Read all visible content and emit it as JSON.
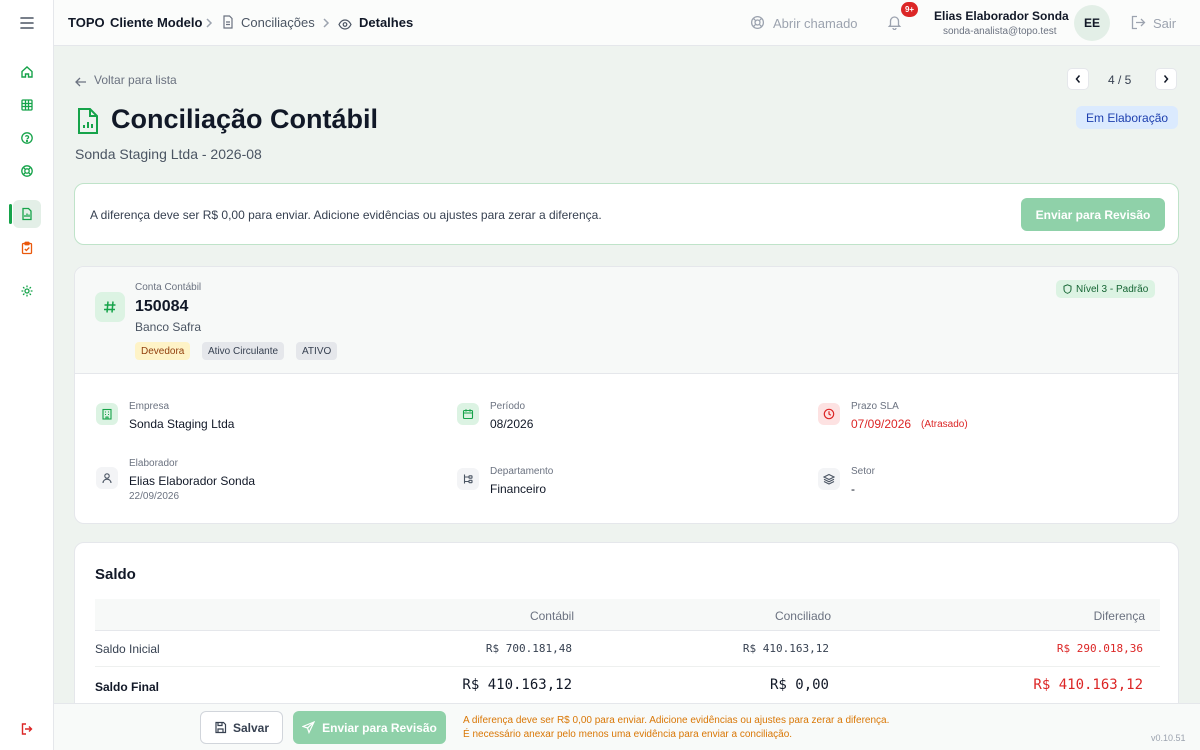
{
  "header": {
    "brand": "TOPO",
    "breadcrumb": {
      "client": "Cliente Modelo",
      "section": "Conciliações",
      "current": "Detalhes"
    },
    "ticket_label": "Abrir chamado",
    "notifications_badge": "9+",
    "user_name": "Elias Elaborador Sonda",
    "user_email": "sonda-analista@topo.test",
    "avatar_initials": "EE",
    "logout_label": "Sair"
  },
  "nav": {
    "back_label": "Voltar para lista",
    "pager": "4 / 5"
  },
  "page": {
    "title": "Conciliação Contábil",
    "subtitle": "Sonda Staging Ltda - 2026-08",
    "status": "Em Elaboração"
  },
  "alert": {
    "message": "A diferença deve ser R$ 0,00 para enviar. Adicione evidências ou ajustes para zerar a diferença.",
    "button": "Enviar para Revisão"
  },
  "account": {
    "label": "Conta Contábil",
    "number": "150084",
    "bank": "Banco Safra",
    "chips": [
      "Devedora",
      "Ativo Circulante",
      "ATIVO"
    ],
    "level": "Nível 3 - Padrão",
    "info": {
      "empresa_label": "Empresa",
      "empresa": "Sonda Staging Ltda",
      "periodo_label": "Período",
      "periodo": "08/2026",
      "prazo_label": "Prazo SLA",
      "prazo": "07/09/2026",
      "prazo_status": "(Atrasado)",
      "elaborador_label": "Elaborador",
      "elaborador": "Elias Elaborador Sonda",
      "elaborador_date": "22/09/2026",
      "departamento_label": "Departamento",
      "departamento": "Financeiro",
      "setor_label": "Setor",
      "setor": "-"
    }
  },
  "saldo": {
    "title": "Saldo",
    "headers": [
      "Contábil",
      "Conciliado",
      "Diferença"
    ],
    "rows": [
      {
        "label": "Saldo Inicial",
        "contabil": "R$ 700.181,48",
        "conciliado": "R$ 410.163,12",
        "diferenca": "R$ 290.018,36"
      },
      {
        "label": "Saldo Final",
        "contabil": "R$ 410.163,12",
        "conciliado": "R$ 0,00",
        "diferenca": "R$ 410.163,12"
      }
    ]
  },
  "footer": {
    "save_label": "Salvar",
    "submit_label": "Enviar para Revisão",
    "warning_1": "A diferença deve ser R$ 0,00 para enviar. Adicione evidências ou ajustes para zerar a diferença.",
    "warning_2": "É necessário anexar pelo menos uma evidência para enviar a conciliação.",
    "version": "v0.10.51"
  },
  "icons": {
    "sidebar": [
      "home-icon",
      "table-icon",
      "help-icon",
      "support-icon",
      "document-icon",
      "clipboard-icon",
      "settings-icon",
      "logout-icon"
    ]
  },
  "colors": {
    "accent": "#16a34a",
    "danger": "#dc2626",
    "warning": "#d97706",
    "status_bg": "#dbeafe"
  }
}
